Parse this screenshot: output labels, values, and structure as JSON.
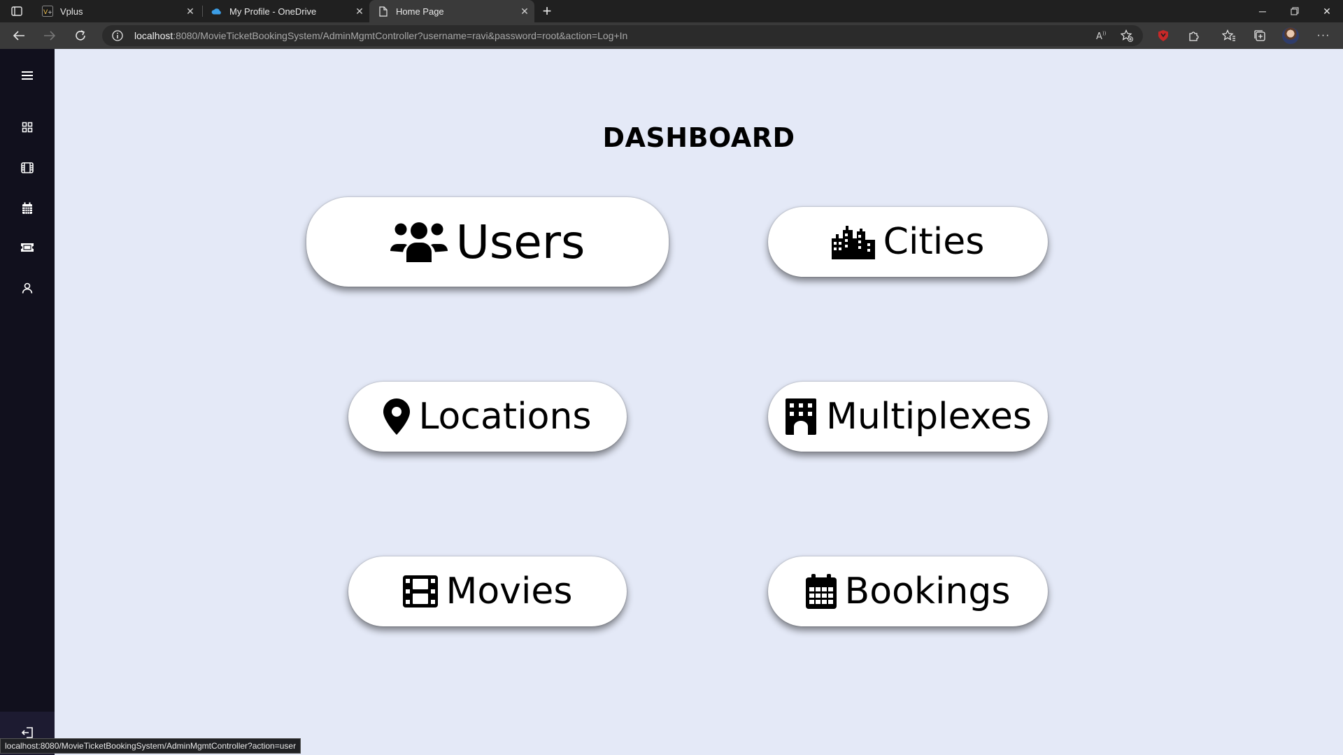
{
  "browser": {
    "tabs": [
      {
        "title": "Vplus",
        "favicon": "vplus-icon",
        "active": false
      },
      {
        "title": "My Profile - OneDrive",
        "favicon": "onedrive-icon",
        "active": false
      },
      {
        "title": "Home Page",
        "favicon": "page-icon",
        "active": true
      }
    ],
    "url_host": "localhost",
    "url_rest": ":8080/MovieTicketBookingSystem/AdminMgmtController?username=ravi&password=root&action=Log+In",
    "status_url": "localhost:8080/MovieTicketBookingSystem/AdminMgmtController?action=user"
  },
  "sidebar": {
    "items": [
      {
        "icon": "menu-icon"
      },
      {
        "icon": "grid-icon"
      },
      {
        "icon": "film-icon"
      },
      {
        "icon": "calendar-icon"
      },
      {
        "icon": "ticket-icon"
      },
      {
        "icon": "user-icon"
      }
    ],
    "logout_icon": "logout-icon"
  },
  "dashboard": {
    "title": "DASHBOARD",
    "cards": [
      {
        "label": "Users",
        "icon": "users-icon"
      },
      {
        "label": "Cities",
        "icon": "city-icon"
      },
      {
        "label": "Locations",
        "icon": "location-pin-icon"
      },
      {
        "label": "Multiplexes",
        "icon": "building-icon"
      },
      {
        "label": "Movies",
        "icon": "film-icon"
      },
      {
        "label": "Bookings",
        "icon": "calendar-icon"
      }
    ]
  },
  "colors": {
    "sidebar_bg": "#11101d",
    "main_bg": "#e4e9f7",
    "card_bg": "#ffffff"
  }
}
